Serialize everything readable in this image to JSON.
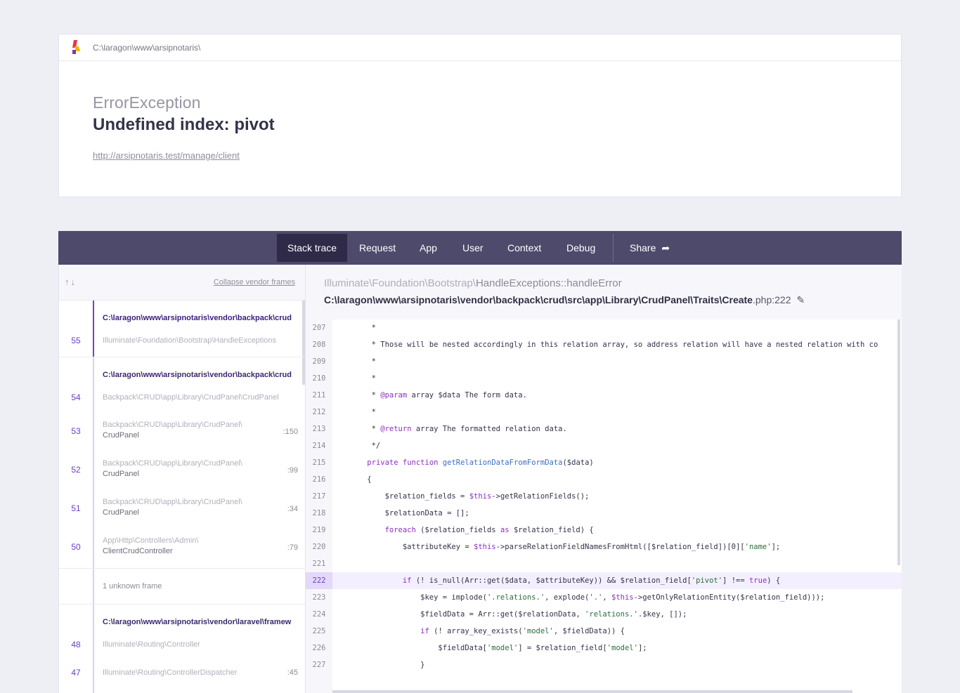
{
  "header": {
    "path": "C:\\laragon\\www\\arsipnotaris\\",
    "exception_type": "ErrorException",
    "message": "Undefined index: pivot",
    "url": "http://arsipnotaris.test/manage/client"
  },
  "tabs": [
    "Stack trace",
    "Request",
    "App",
    "User",
    "Context",
    "Debug"
  ],
  "share_label": "Share",
  "stack": {
    "collapse_label": "Collapse vendor frames",
    "groups": [
      {
        "file": "C:\\laragon\\www\\arsipnotaris\\vendor\\backpack\\crud",
        "frames": [
          {
            "num": "55",
            "cls": "Illuminate\\Foundation\\Bootstrap\\HandleExceptions",
            "ln": ""
          }
        ]
      },
      {
        "file": "C:\\laragon\\www\\arsipnotaris\\vendor\\backpack\\crud",
        "frames": [
          {
            "num": "54",
            "cls": "Backpack\\CRUD\\app\\Library\\CrudPanel\\CrudPanel",
            "ln": ""
          },
          {
            "num": "53",
            "ns": "Backpack\\CRUD\\app\\Library\\CrudPanel\\",
            "cls": "CrudPanel",
            "ln": ":150"
          },
          {
            "num": "52",
            "ns": "Backpack\\CRUD\\app\\Library\\CrudPanel\\",
            "cls": "CrudPanel",
            "ln": ":99"
          },
          {
            "num": "51",
            "ns": "Backpack\\CRUD\\app\\Library\\CrudPanel\\",
            "cls": "CrudPanel",
            "ln": ":34"
          },
          {
            "num": "50",
            "ns": "App\\Http\\Controllers\\Admin\\",
            "cls": "ClientCrudController",
            "ln": ":79"
          }
        ]
      },
      {
        "unknown": "1 unknown frame"
      },
      {
        "file": "C:\\laragon\\www\\arsipnotaris\\vendor\\laravel\\framew",
        "frames": [
          {
            "num": "48",
            "cls": "Illuminate\\Routing\\Controller",
            "ln": ""
          },
          {
            "num": "47",
            "cls": "Illuminate\\Routing\\ControllerDispatcher",
            "ln": ":45"
          }
        ]
      }
    ]
  },
  "code": {
    "class_ns": "Illuminate\\Foundation\\Bootstrap\\",
    "class_name": "HandleExceptions::handleError",
    "file_path": "C:\\laragon\\www\\arsipnotaris\\vendor\\backpack\\crud\\src\\app\\Library\\CrudPanel\\Traits\\Create",
    "file_ext_line": ".php:222",
    "highlight_line": "222",
    "lines": [
      {
        "n": "207",
        "t": "     *"
      },
      {
        "n": "208",
        "t": "     * Those will be nested accordingly in this relation array, so address relation will have a nested relation with co"
      },
      {
        "n": "209",
        "t": "     *"
      },
      {
        "n": "210",
        "t": "     *"
      },
      {
        "n": "211",
        "t": "     * @param array $data The form data."
      },
      {
        "n": "212",
        "t": "     *"
      },
      {
        "n": "213",
        "t": "     * @return array The formatted relation data."
      },
      {
        "n": "214",
        "t": "     */"
      },
      {
        "n": "215",
        "t": "    private function getRelationDataFromFormData($data)"
      },
      {
        "n": "216",
        "t": "    {"
      },
      {
        "n": "217",
        "t": "        $relation_fields = $this->getRelationFields();"
      },
      {
        "n": "218",
        "t": "        $relationData = [];"
      },
      {
        "n": "219",
        "t": "        foreach ($relation_fields as $relation_field) {"
      },
      {
        "n": "220",
        "t": "            $attributeKey = $this->parseRelationFieldNamesFromHtml([$relation_field])[0]['name'];"
      },
      {
        "n": "221",
        "t": ""
      },
      {
        "n": "222",
        "t": "            if (! is_null(Arr::get($data, $attributeKey)) && $relation_field['pivot'] !== true) {"
      },
      {
        "n": "223",
        "t": "                $key = implode('.relations.', explode('.', $this->getOnlyRelationEntity($relation_field)));"
      },
      {
        "n": "224",
        "t": "                $fieldData = Arr::get($relationData, 'relations.'.$key, []);"
      },
      {
        "n": "225",
        "t": "                if (! array_key_exists('model', $fieldData)) {"
      },
      {
        "n": "226",
        "t": "                    $fieldData['model'] = $relation_field['model'];"
      },
      {
        "n": "227",
        "t": "                }"
      }
    ]
  }
}
